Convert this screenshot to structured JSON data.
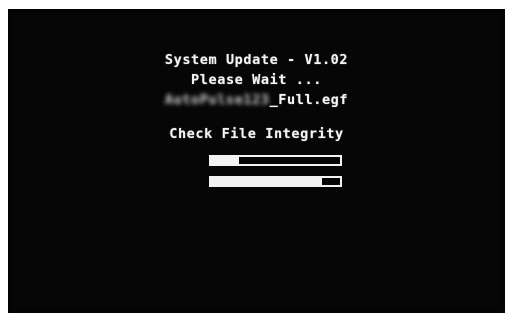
{
  "screen": {
    "title": "System Update - V1.02",
    "wait_text": "Please Wait ...",
    "file_name_blurred": "AutoPulse123",
    "file_name_suffix": "_Full.egf",
    "status_text": "Check File Integrity"
  },
  "progress": {
    "bar1_fraction": 0.22,
    "bar2_fraction": 0.86
  },
  "colors": {
    "background": "#060606",
    "foreground": "#f4f4f4"
  }
}
